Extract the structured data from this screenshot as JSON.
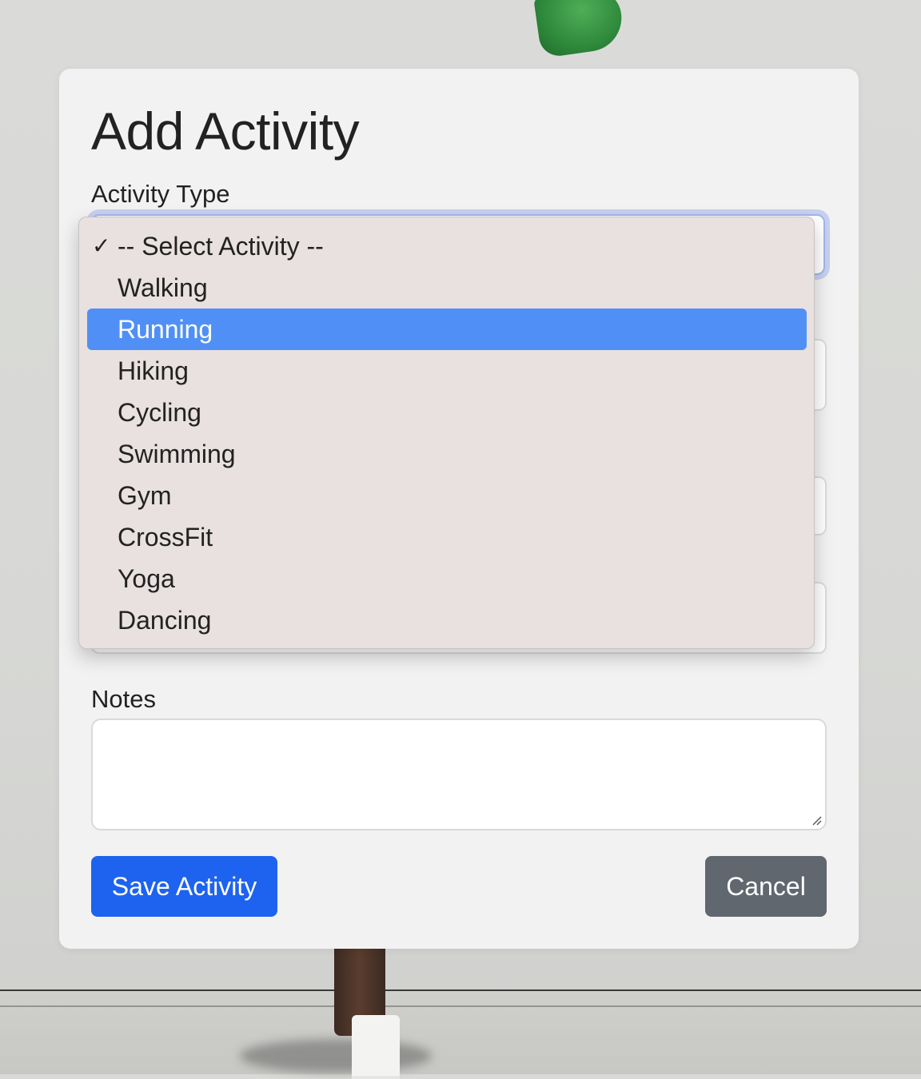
{
  "form": {
    "title": "Add Activity",
    "activity_type_label": "Activity Type",
    "notes_label": "Notes",
    "notes_value": "",
    "save_label": "Save Activity",
    "cancel_label": "Cancel"
  },
  "dropdown": {
    "selected_index": 0,
    "highlighted_index": 2,
    "options": [
      "-- Select Activity --",
      "Walking",
      "Running",
      "Hiking",
      "Cycling",
      "Swimming",
      "Gym",
      "CrossFit",
      "Yoga",
      "Dancing"
    ]
  },
  "colors": {
    "primary": "#1d63f0",
    "secondary": "#60676f",
    "highlight": "#5090f6"
  }
}
